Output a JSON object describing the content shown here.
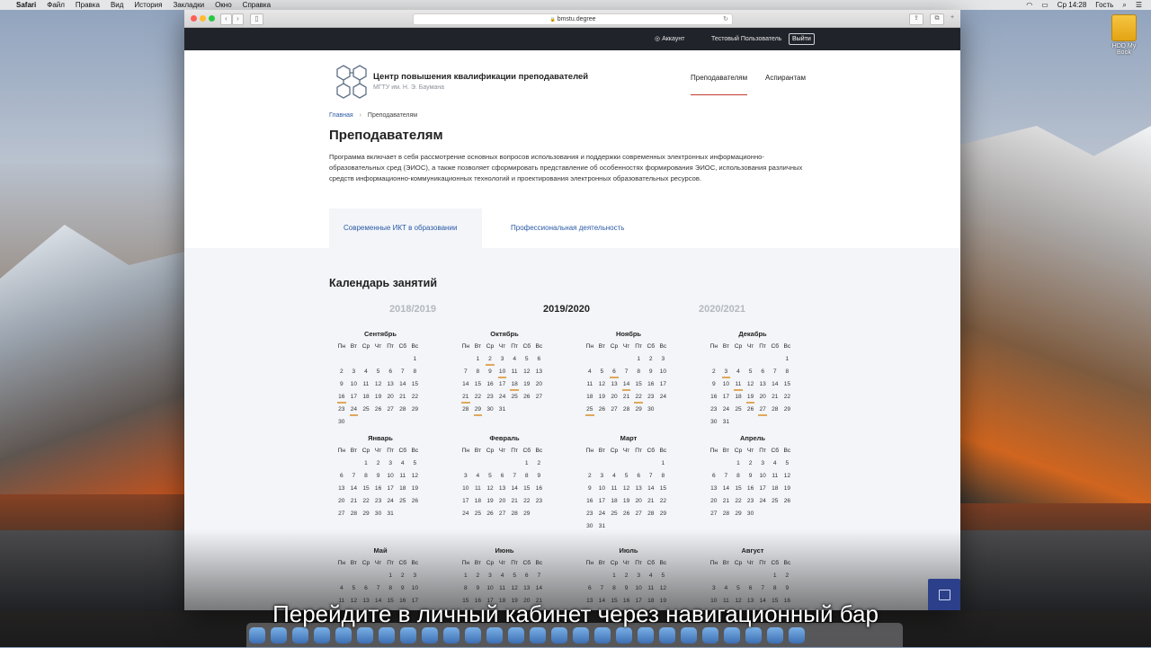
{
  "menubar": {
    "app": "Safari",
    "items": [
      "Файл",
      "Правка",
      "Вид",
      "История",
      "Закладки",
      "Окно",
      "Справка"
    ],
    "clock": "Ср 14:28",
    "user": "Гость"
  },
  "desktop": {
    "disk_label": "HDD My Book"
  },
  "browser": {
    "url": "bmstu.degree",
    "lock": "🔒"
  },
  "topbar": {
    "account": "Аккаунт",
    "user": "Тестовый Пользователь",
    "logout": "Выйти"
  },
  "header": {
    "title": "Центр повышения квалификации преподавателей",
    "subtitle": "МГТУ им. Н. Э. Баумана",
    "nav": [
      "Преподавателям",
      "Аспирантам"
    ]
  },
  "breadcrumbs": {
    "home": "Главная",
    "current": "Преподавателям"
  },
  "page": {
    "title": "Преподавателям",
    "description": "Программа включает в себя рассмотрение основных вопросов использования и поддержки современных электронных информационно-образовательных сред (ЭИОС), а также позволяет сформировать представление об особенностях формирования ЭИОС, использования различных средств информационно-коммуникационных технологий и проектирования электронных образовательных ресурсов."
  },
  "tabs": [
    "Современные ИКТ в образовании",
    "Профессиональная деятельность"
  ],
  "calendar": {
    "title": "Календарь занятий",
    "years": [
      "2018/2019",
      "2019/2020",
      "2020/2021"
    ],
    "weekdays": [
      "Пн",
      "Вт",
      "Ср",
      "Чт",
      "Пт",
      "Сб",
      "Вс"
    ],
    "months": [
      {
        "name": "Сентябрь",
        "offset": 6,
        "days": 30,
        "marked": [
          16,
          24
        ]
      },
      {
        "name": "Октябрь",
        "offset": 1,
        "days": 31,
        "marked": [
          2,
          10,
          18,
          21,
          29
        ]
      },
      {
        "name": "Ноябрь",
        "offset": 4,
        "days": 30,
        "marked": [
          6,
          14,
          22,
          25
        ]
      },
      {
        "name": "Декабрь",
        "offset": 6,
        "days": 31,
        "marked": [
          3,
          11,
          19,
          27
        ]
      },
      {
        "name": "Январь",
        "offset": 2,
        "days": 31,
        "marked": []
      },
      {
        "name": "Февраль",
        "offset": 5,
        "days": 29,
        "marked": []
      },
      {
        "name": "Март",
        "offset": 6,
        "days": 31,
        "marked": []
      },
      {
        "name": "Апрель",
        "offset": 2,
        "days": 30,
        "marked": []
      },
      {
        "name": "Май",
        "offset": 4,
        "days": 31,
        "marked": []
      },
      {
        "name": "Июнь",
        "offset": 0,
        "days": 30,
        "marked": []
      },
      {
        "name": "Июль",
        "offset": 2,
        "days": 31,
        "marked": []
      },
      {
        "name": "Август",
        "offset": 5,
        "days": 31,
        "marked": []
      }
    ]
  },
  "subtitle": "Перейдите в личный кабинет через навигационный бар"
}
